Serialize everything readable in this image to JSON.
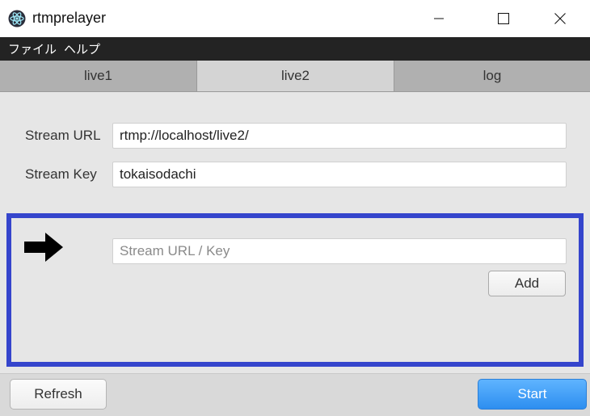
{
  "window": {
    "title": "rtmprelayer",
    "app_icon": "electron-atom-icon",
    "controls": [
      "minimize-icon",
      "maximize-icon",
      "close-icon"
    ]
  },
  "menubar": {
    "items": [
      {
        "label": "ファイル"
      },
      {
        "label": "ヘルプ"
      }
    ]
  },
  "tabs": [
    {
      "label": "live1",
      "active": false
    },
    {
      "label": "live2",
      "active": true
    },
    {
      "label": "log",
      "active": false
    }
  ],
  "form": {
    "stream_url_label": "Stream URL",
    "stream_url_value": "rtmp://localhost/live2/",
    "stream_key_label": "Stream Key",
    "stream_key_value": "tokaisodachi"
  },
  "relay": {
    "arrow_icon": "right-arrow-icon",
    "input_value": "",
    "input_placeholder": "Stream URL / Key",
    "add_label": "Add",
    "border_color": "#3545cc"
  },
  "footer": {
    "refresh_label": "Refresh",
    "start_label": "Start",
    "start_color": "#2d8ef0"
  }
}
